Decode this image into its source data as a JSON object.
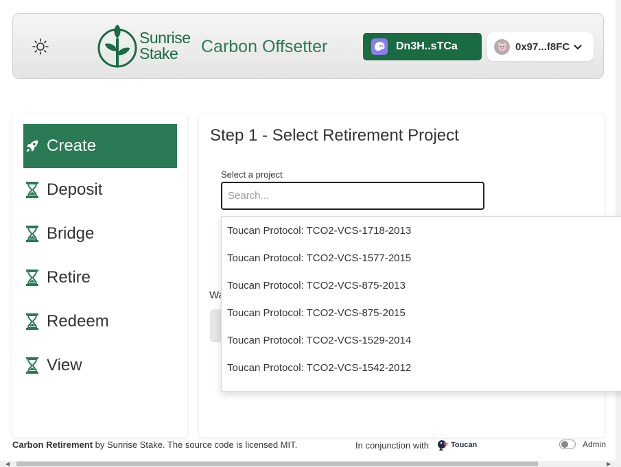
{
  "header": {
    "logo_text_line1": "Sunrise",
    "logo_text_line2": "Stake",
    "app_title": "Carbon Offsetter",
    "wallet_button_label": "Dn3H..sTCa",
    "account_button_label": "0x97...f8FC",
    "icons": {
      "theme": "sun-icon",
      "wallet": "phantom-ghost-icon",
      "account": "avatar-icon",
      "account_chevron": "chevron-down-icon"
    }
  },
  "sidebar": {
    "items": [
      {
        "label": "Create",
        "icon": "rocket-icon",
        "active": true
      },
      {
        "label": "Deposit",
        "icon": "hourglass-icon",
        "active": false
      },
      {
        "label": "Bridge",
        "icon": "hourglass-icon",
        "active": false
      },
      {
        "label": "Retire",
        "icon": "hourglass-icon",
        "active": false
      },
      {
        "label": "Redeem",
        "icon": "hourglass-icon",
        "active": false
      },
      {
        "label": "View",
        "icon": "hourglass-icon",
        "active": false
      }
    ]
  },
  "main": {
    "step_title": "Step 1 - Select Retirement Project",
    "select_label": "Select a project",
    "search_placeholder": "Search...",
    "search_value": "",
    "partial_label": "Wa"
  },
  "dropdown": {
    "options": [
      "Toucan Protocol: TCO2-VCS-1718-2013",
      "Toucan Protocol: TCO2-VCS-1577-2015",
      "Toucan Protocol: TCO2-VCS-875-2013",
      "Toucan Protocol: TCO2-VCS-875-2015",
      "Toucan Protocol: TCO2-VCS-1529-2014",
      "Toucan Protocol: TCO2-VCS-1542-2012"
    ]
  },
  "footer": {
    "credit_bold": "Carbon Retirement",
    "credit_rest": " by Sunrise Stake. The source code is licensed MIT.",
    "partner_text": "In conjunction with",
    "partner_logo_text": "Toucan",
    "admin_label": "Admin"
  },
  "colors": {
    "brand_green": "#2a7a55",
    "wallet_green": "#1a6a42",
    "phantom_purple": "#8b7cf0"
  }
}
